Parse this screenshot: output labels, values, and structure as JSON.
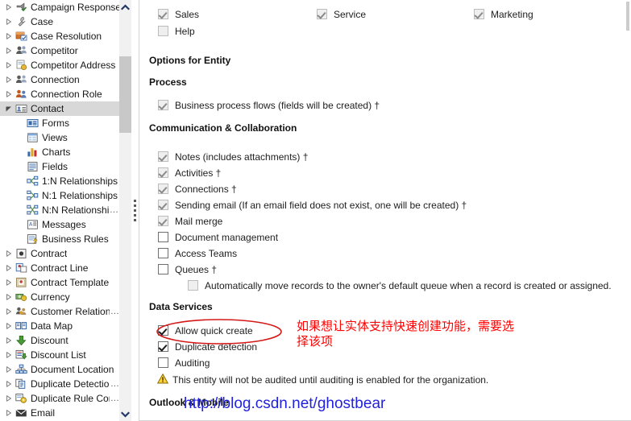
{
  "sidebar": {
    "items": [
      {
        "label": "Campaign Response",
        "level": "root",
        "expander": "collapsed",
        "icon": "campaign-response-icon",
        "truncated": false,
        "selected": false
      },
      {
        "label": "Case",
        "level": "root",
        "expander": "collapsed",
        "icon": "case-wrench-icon",
        "truncated": false,
        "selected": false
      },
      {
        "label": "Case Resolution",
        "level": "root",
        "expander": "collapsed",
        "icon": "case-resolution-icon",
        "truncated": false,
        "selected": false
      },
      {
        "label": "Competitor",
        "level": "root",
        "expander": "collapsed",
        "icon": "competitor-icon",
        "truncated": false,
        "selected": false
      },
      {
        "label": "Competitor Address",
        "level": "root",
        "expander": "collapsed",
        "icon": "competitor-address-icon",
        "truncated": false,
        "selected": false
      },
      {
        "label": "Connection",
        "level": "root",
        "expander": "collapsed",
        "icon": "connection-icon",
        "truncated": false,
        "selected": false
      },
      {
        "label": "Connection Role",
        "level": "root",
        "expander": "collapsed",
        "icon": "connection-role-icon",
        "truncated": false,
        "selected": false
      },
      {
        "label": "Contact",
        "level": "root",
        "expander": "expanded",
        "icon": "contact-card-icon",
        "truncated": false,
        "selected": true
      },
      {
        "label": "Forms",
        "level": "child",
        "expander": "none",
        "icon": "forms-icon",
        "truncated": false,
        "selected": false
      },
      {
        "label": "Views",
        "level": "child",
        "expander": "none",
        "icon": "views-icon",
        "truncated": false,
        "selected": false
      },
      {
        "label": "Charts",
        "level": "child",
        "expander": "none",
        "icon": "charts-icon",
        "truncated": false,
        "selected": false
      },
      {
        "label": "Fields",
        "level": "child",
        "expander": "none",
        "icon": "fields-icon",
        "truncated": false,
        "selected": false
      },
      {
        "label": "1:N Relationships",
        "level": "child",
        "expander": "none",
        "icon": "one-to-many-icon",
        "truncated": false,
        "selected": false
      },
      {
        "label": "N:1 Relationships",
        "level": "child",
        "expander": "none",
        "icon": "many-to-one-icon",
        "truncated": false,
        "selected": false
      },
      {
        "label": "N:N Relationshi",
        "level": "child",
        "expander": "none",
        "icon": "many-to-many-icon",
        "truncated": true,
        "selected": false
      },
      {
        "label": "Messages",
        "level": "child",
        "expander": "none",
        "icon": "messages-icon",
        "truncated": false,
        "selected": false
      },
      {
        "label": "Business Rules",
        "level": "child",
        "expander": "none",
        "icon": "business-rules-icon",
        "truncated": false,
        "selected": false
      },
      {
        "label": "Contract",
        "level": "root",
        "expander": "collapsed",
        "icon": "contract-icon",
        "truncated": false,
        "selected": false
      },
      {
        "label": "Contract Line",
        "level": "root",
        "expander": "collapsed",
        "icon": "contract-line-icon",
        "truncated": false,
        "selected": false
      },
      {
        "label": "Contract Template",
        "level": "root",
        "expander": "collapsed",
        "icon": "contract-template-icon",
        "truncated": false,
        "selected": false
      },
      {
        "label": "Currency",
        "level": "root",
        "expander": "collapsed",
        "icon": "currency-icon",
        "truncated": false,
        "selected": false
      },
      {
        "label": "Customer Relations",
        "level": "root",
        "expander": "collapsed",
        "icon": "customer-relations-icon",
        "truncated": true,
        "selected": false
      },
      {
        "label": "Data Map",
        "level": "root",
        "expander": "collapsed",
        "icon": "data-map-icon",
        "truncated": false,
        "selected": false
      },
      {
        "label": "Discount",
        "level": "root",
        "expander": "collapsed",
        "icon": "discount-icon",
        "truncated": false,
        "selected": false
      },
      {
        "label": "Discount List",
        "level": "root",
        "expander": "collapsed",
        "icon": "discount-list-icon",
        "truncated": false,
        "selected": false
      },
      {
        "label": "Document Location",
        "level": "root",
        "expander": "collapsed",
        "icon": "document-location-icon",
        "truncated": false,
        "selected": false
      },
      {
        "label": "Duplicate Detection",
        "level": "root",
        "expander": "collapsed",
        "icon": "duplicate-detection-icon",
        "truncated": true,
        "selected": false
      },
      {
        "label": "Duplicate Rule Con",
        "level": "root",
        "expander": "collapsed",
        "icon": "duplicate-rule-condition-icon",
        "truncated": true,
        "selected": false
      },
      {
        "label": "Email",
        "level": "root",
        "expander": "collapsed",
        "icon": "email-icon",
        "truncated": false,
        "selected": false
      }
    ],
    "truncation_marker": "..."
  },
  "main": {
    "areas": [
      {
        "label": "Sales",
        "state": "disabled-checked"
      },
      {
        "label": "Service",
        "state": "disabled-checked"
      },
      {
        "label": "Marketing",
        "state": "disabled-checked"
      },
      {
        "label": "Help",
        "state": "disabled-unchecked"
      }
    ],
    "headings": {
      "options_for_entity": "Options for Entity",
      "process": "Process",
      "communication": "Communication & Collaboration",
      "data_services": "Data Services",
      "outlook_mobile": "Outlook & Mobile"
    },
    "process_options": [
      {
        "label": "Business process flows (fields will be created) †",
        "state": "disabled-checked"
      }
    ],
    "communication_options": [
      {
        "label": "Notes (includes attachments) †",
        "state": "disabled-checked"
      },
      {
        "label": "Activities †",
        "state": "disabled-checked"
      },
      {
        "label": "Connections †",
        "state": "disabled-checked"
      },
      {
        "label": "Sending email (If an email field does not exist, one will be created) †",
        "state": "disabled-checked"
      },
      {
        "label": "Mail merge",
        "state": "disabled-checked"
      },
      {
        "label": "Document management",
        "state": "unchecked"
      },
      {
        "label": "Access Teams",
        "state": "unchecked"
      },
      {
        "label": "Queues †",
        "state": "unchecked"
      },
      {
        "label": "Automatically move records to the owner's default queue when a record is created or assigned.",
        "state": "disabled-unchecked",
        "indented": true
      }
    ],
    "data_services_options": [
      {
        "label": "Allow quick create",
        "state": "checked"
      },
      {
        "label": "Duplicate detection",
        "state": "checked"
      },
      {
        "label": "Auditing",
        "state": "unchecked"
      }
    ],
    "warning": {
      "icon": "warning-triangle-icon",
      "text": "This entity will not be audited until auditing is enabled for the organization."
    }
  },
  "annotations": {
    "note_text": "如果想让实体支持快速创建功能，需要选择该项",
    "note_color": "#ff0000",
    "highlight_target": "Allow quick create",
    "watermark_url": "http://blog.csdn.net/ghostbear",
    "watermark_color": "#2222dd"
  }
}
